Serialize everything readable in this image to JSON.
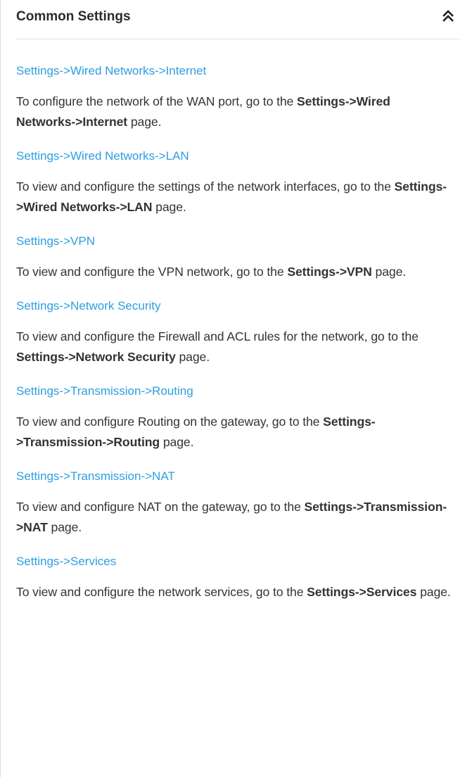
{
  "section": {
    "title": "Common Settings",
    "collapse_icon": "double-chevron-up-icon"
  },
  "entries": [
    {
      "link": "Settings->Wired Networks->Internet",
      "desc_before": "To configure the network of the WAN port, go to the ",
      "desc_bold": "Settings->Wired Networks->Internet",
      "desc_after": " page."
    },
    {
      "link": "Settings->Wired Networks->LAN",
      "desc_before": "To view and configure the settings of the network interfaces, go to the ",
      "desc_bold": "Settings->Wired Networks->LAN",
      "desc_after": " page."
    },
    {
      "link": "Settings->VPN",
      "desc_before": "To view and configure the VPN network, go to the ",
      "desc_bold": "Settings->VPN",
      "desc_after": " page."
    },
    {
      "link": "Settings->Network Security",
      "desc_before": "To view and configure the Firewall and ACL rules for the network, go to the ",
      "desc_bold": "Settings->Network Security",
      "desc_after": " page."
    },
    {
      "link": "Settings->Transmission->Routing",
      "desc_before": "To view and configure Routing on the gateway, go to the ",
      "desc_bold": "Settings->Transmission->Routing",
      "desc_after": " page."
    },
    {
      "link": "Settings->Transmission->NAT",
      "desc_before": "To view and configure NAT on the gateway, go to the ",
      "desc_bold": "Settings->Transmission->NAT",
      "desc_after": " page."
    },
    {
      "link": "Settings->Services",
      "desc_before": "To view and configure the network services, go to the ",
      "desc_bold": "Settings->Services",
      "desc_after": " page."
    }
  ],
  "colors": {
    "link": "#2e9ee0",
    "text": "#333333",
    "title": "#2b2b2b"
  }
}
